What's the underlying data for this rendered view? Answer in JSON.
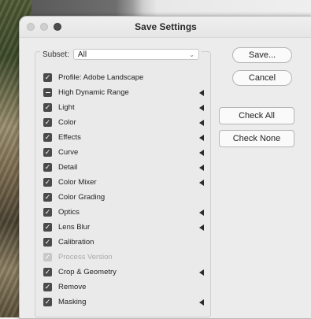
{
  "dialog": {
    "title": "Save Settings"
  },
  "subset": {
    "label": "Subset:",
    "value": "All"
  },
  "items": [
    {
      "label": "Profile: Adobe Landscape",
      "state": "checked",
      "has_arrow": false
    },
    {
      "label": "High Dynamic Range",
      "state": "mixed",
      "has_arrow": true
    },
    {
      "label": "Light",
      "state": "checked",
      "has_arrow": true
    },
    {
      "label": "Color",
      "state": "checked",
      "has_arrow": true
    },
    {
      "label": "Effects",
      "state": "checked",
      "has_arrow": true
    },
    {
      "label": "Curve",
      "state": "checked",
      "has_arrow": true
    },
    {
      "label": "Detail",
      "state": "checked",
      "has_arrow": true
    },
    {
      "label": "Color Mixer",
      "state": "checked",
      "has_arrow": true
    },
    {
      "label": "Color Grading",
      "state": "checked",
      "has_arrow": false
    },
    {
      "label": "Optics",
      "state": "checked",
      "has_arrow": true
    },
    {
      "label": "Lens Blur",
      "state": "checked",
      "has_arrow": true
    },
    {
      "label": "Calibration",
      "state": "checked",
      "has_arrow": false
    },
    {
      "label": "Process Version",
      "state": "disabled",
      "has_arrow": false
    },
    {
      "label": "Crop & Geometry",
      "state": "checked",
      "has_arrow": true
    },
    {
      "label": "Remove",
      "state": "checked",
      "has_arrow": false
    },
    {
      "label": "Masking",
      "state": "checked",
      "has_arrow": true
    }
  ],
  "buttons": {
    "save": "Save...",
    "cancel": "Cancel",
    "check_all": "Check All",
    "check_none": "Check None"
  }
}
